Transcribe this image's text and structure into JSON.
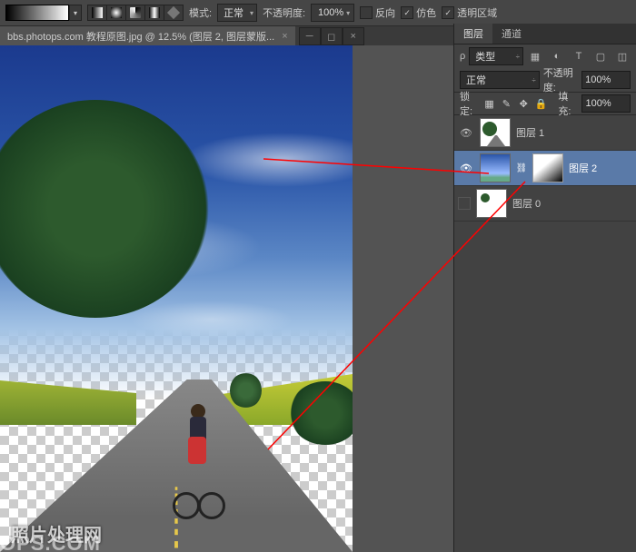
{
  "toolbar": {
    "mode_label": "模式:",
    "mode_value": "正常",
    "opacity_label": "不透明度:",
    "opacity_value": "100%",
    "reverse_label": "反向",
    "dither_label": "仿色",
    "transparency_label": "透明区域",
    "reverse_checked": false,
    "dither_checked": true,
    "transparency_checked": true
  },
  "document": {
    "tab_title": "bbs.photops.com 教程原图.jpg @ 12.5% (图层 2, 图层蒙版...",
    "watermark1": "照片处理网",
    "watermark2": "OPS.COM"
  },
  "layers_panel": {
    "tab_layers": "图层",
    "tab_channels": "通道",
    "filter_label": "类型",
    "blend_mode": "正常",
    "opacity_label": "不透明度:",
    "opacity_value": "100%",
    "lock_label": "锁定:",
    "fill_label": "填充:",
    "fill_value": "100%",
    "layers": [
      {
        "name": "图层 1",
        "visible": true,
        "selected": false,
        "has_mask": false
      },
      {
        "name": "图层 2",
        "visible": true,
        "selected": true,
        "has_mask": true
      },
      {
        "name": "图层 0",
        "visible": false,
        "selected": false,
        "has_mask": false
      }
    ]
  }
}
